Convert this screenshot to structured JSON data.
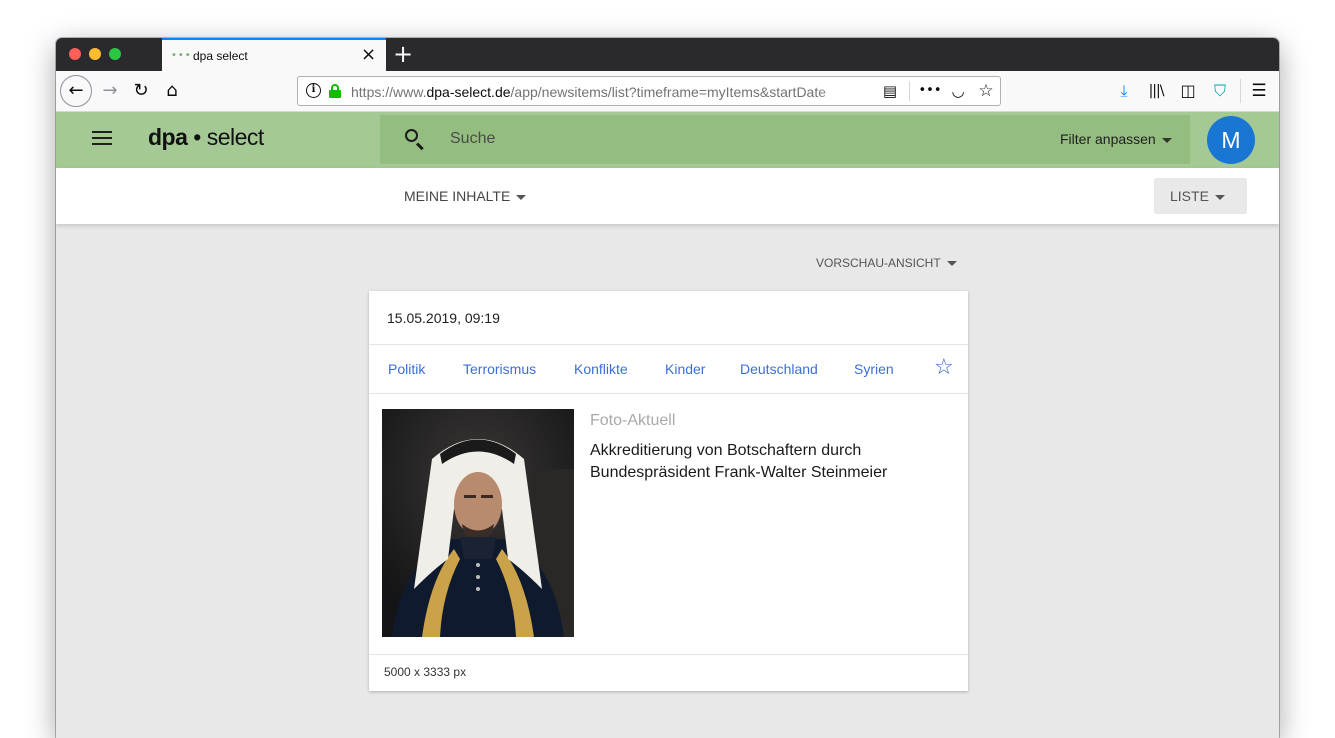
{
  "browser": {
    "tab_title": "dpa select",
    "url_prefix": "https://www.",
    "url_domain": "dpa-select.de",
    "url_path": "/app/newsitems/list?timeframe=myItems&startDate"
  },
  "app": {
    "brand_bold": "dpa",
    "brand_rest": " • select",
    "search_placeholder": "Suche",
    "filter_label": "Filter anpassen",
    "avatar_initial": "M",
    "avatar_color": "#1976d2",
    "header_color": "#a5c994"
  },
  "subbar": {
    "scope_label": "MEINE INHALTE",
    "view_label": "LISTE"
  },
  "content": {
    "preview_label": "VORSCHAU-ANSICHT",
    "card": {
      "date": "15.05.2019, 09:19",
      "tags": [
        "Politik",
        "Terrorismus",
        "Konflikte",
        "Kinder",
        "Deutschland",
        "Syrien"
      ],
      "source": "Foto-Aktuell",
      "headline": "Akkreditierung von Botschaftern durch Bundespräsident Frank-Walter Steinmeier",
      "dimensions": "5000 x 3333 px"
    }
  },
  "icons": {
    "back": "back-arrow-icon",
    "forward": "forward-arrow-icon",
    "reload": "reload-icon",
    "home": "home-icon",
    "favorite": "star-outline-icon"
  }
}
